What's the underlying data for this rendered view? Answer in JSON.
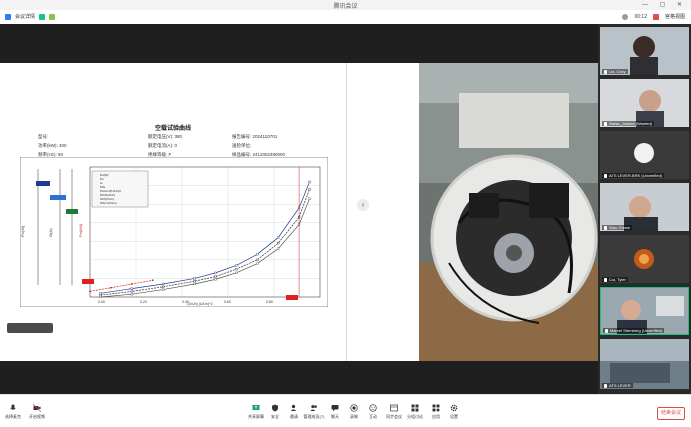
{
  "window": {
    "title": "腾讯会议"
  },
  "infobar": {
    "left_items": [
      "会议详情"
    ],
    "timer": "00:12",
    "view_label": "宫格视图"
  },
  "document": {
    "title": "空载试验曲线",
    "info_rows": [
      [
        "型号:",
        "额定电压(V): 380",
        "报告编号: 2024110701"
      ],
      [
        "功率(kW): 400",
        "额定电流(A): 0",
        "送检单位:"
      ],
      [
        "频率(Hz): 50",
        "绝缘等级: F",
        "样品编号: 2412002480000"
      ]
    ],
    "legend": [
      "Po(W)",
      "Po",
      "Io",
      "P0s",
      "Pcore=f(U/Un)2",
      "P0=f(U/Un)",
      "I0=f(U/Un)",
      "P0s=f(U/Un)"
    ],
    "x_ticks": [
      "0.00",
      "0.20",
      "0.40",
      "0.60",
      "0.80"
    ],
    "x_label": "(U/Un)  (U/Un)^2",
    "y_axis_labels": [
      "Po(W)",
      "I0(A)",
      "Po(kW)"
    ]
  },
  "chart_data": {
    "type": "line",
    "x": [
      0.05,
      0.2,
      0.35,
      0.5,
      0.6,
      0.7,
      0.8,
      0.9,
      1.0,
      1.05
    ],
    "series": [
      {
        "values": [
          0.2,
          0.45,
          0.7,
          1.0,
          1.3,
          1.7,
          2.3,
          3.2,
          4.8,
          6.2
        ]
      },
      {
        "values": [
          0.1,
          0.3,
          0.55,
          0.85,
          1.1,
          1.5,
          2.0,
          2.9,
          4.3,
          5.8
        ]
      },
      {
        "values": [
          0.0,
          0.15,
          0.4,
          0.7,
          0.95,
          1.3,
          1.8,
          2.6,
          3.9,
          5.3
        ]
      }
    ],
    "extra_series": [
      {
        "values": [
          0.3,
          0.5,
          0.7,
          0.9
        ],
        "x": [
          0.0,
          0.1,
          0.2,
          0.3
        ]
      }
    ],
    "xlim": [
      0,
      1.1
    ],
    "ylim": [
      0,
      7
    ],
    "colors": [
      "#1f3c8f",
      "#2a2a2a",
      "#555555",
      "#c82020"
    ]
  },
  "participants": [
    {
      "name": "Lin, Cecy"
    },
    {
      "name": "Swiss_Joshua (Wanted)"
    },
    {
      "name": "ATS LEVER-BRK (Unverified)"
    },
    {
      "name": "Xiao, Edwin"
    },
    {
      "name": "Cui, Tyler"
    },
    {
      "name": "Marcel Sternberg (Unverified)"
    },
    {
      "name": "ATS LEVER"
    }
  ],
  "toolbar": {
    "left": [
      {
        "label": "选择麦克",
        "icon": "microphone-icon"
      },
      {
        "label": "开启视频",
        "icon": "camera-icon"
      }
    ],
    "center": [
      {
        "label": "共享屏幕",
        "icon": "share-screen-icon"
      },
      {
        "label": "安全",
        "icon": "shield-icon"
      },
      {
        "label": "邀请",
        "icon": "invite-icon"
      },
      {
        "label": "管理成员(7)",
        "icon": "members-icon"
      },
      {
        "label": "聊天",
        "icon": "chat-icon"
      },
      {
        "label": "录制",
        "icon": "record-icon"
      },
      {
        "label": "互动",
        "icon": "reaction-icon"
      },
      {
        "label": "同步会议",
        "icon": "sync-icon"
      },
      {
        "label": "分组讨论",
        "icon": "breakout-icon"
      },
      {
        "label": "应用",
        "icon": "apps-icon"
      },
      {
        "label": "设置",
        "icon": "gear-icon"
      }
    ],
    "end_label": "结束会议"
  }
}
